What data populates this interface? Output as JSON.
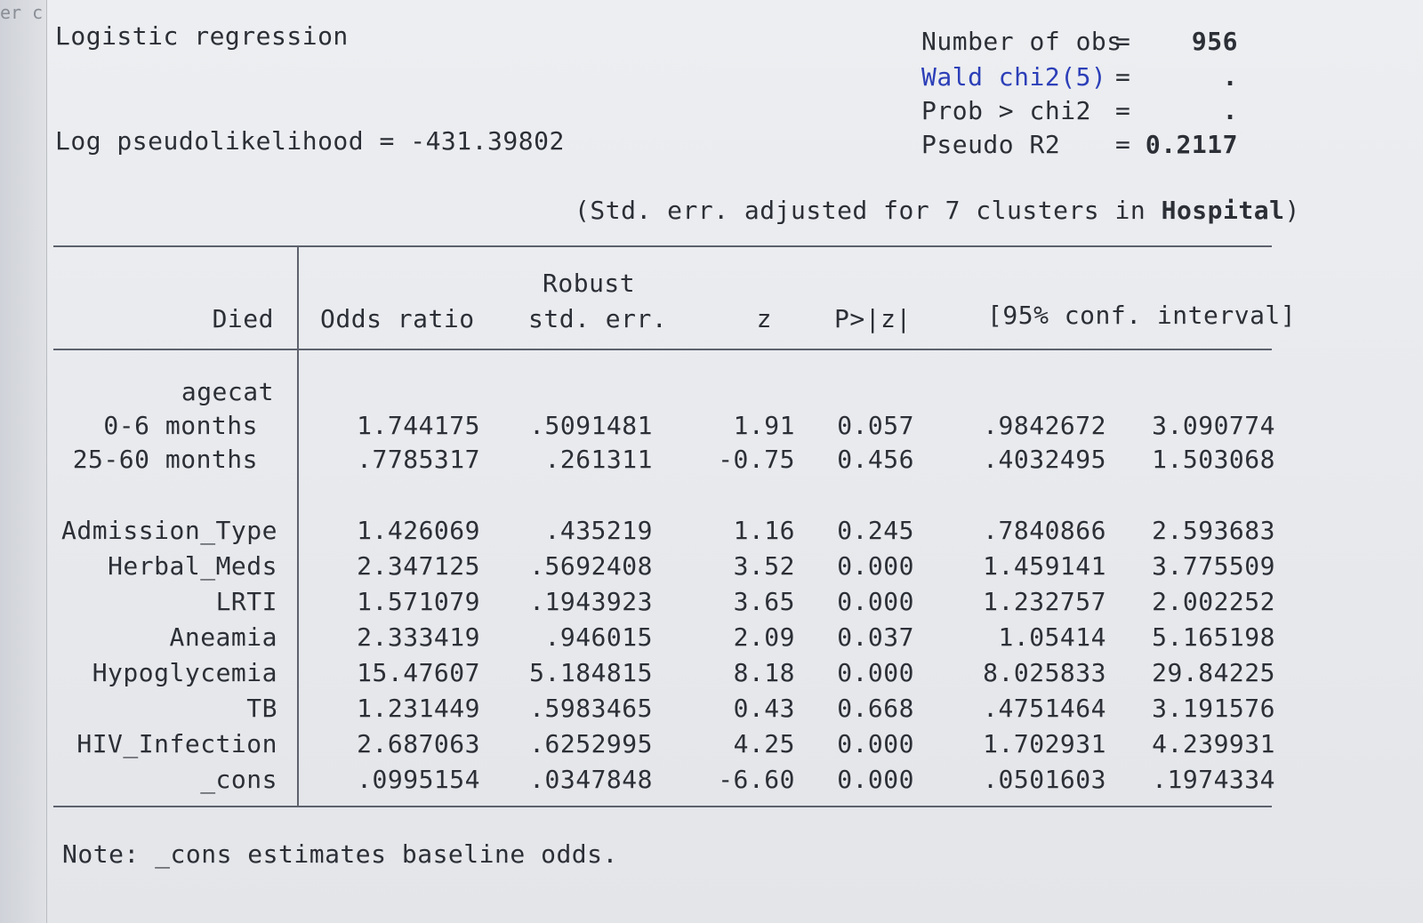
{
  "sidebar": {
    "tab_fragment": "er c"
  },
  "header": {
    "title": "Logistic regression",
    "loglik": "Log pseudolikelihood = -431.39802",
    "stats": [
      {
        "label": "Number of obs",
        "eq": "=",
        "value": "956",
        "link": false
      },
      {
        "label": "Wald chi2(5)",
        "eq": "=",
        "value": ".",
        "link": true
      },
      {
        "label": "Prob > chi2",
        "eq": "=",
        "value": ".",
        "link": false
      },
      {
        "label": "Pseudo R2",
        "eq": "=",
        "value": "0.2117",
        "link": false
      }
    ],
    "cluster_note_prefix": "(Std. err. adjusted for 7 clusters in ",
    "cluster_var": "Hospital",
    "cluster_note_suffix": ")"
  },
  "table": {
    "depvar": "Died",
    "col_odds": "Odds ratio",
    "col_robust": "Robust",
    "col_se": "std. err.",
    "col_z": "z",
    "col_p": "P>|z|",
    "col_ci": "[95% conf. interval]",
    "group_label": "agecat",
    "rows": [
      {
        "label": "0-6 months",
        "or": "1.744175",
        "se": ".5091481",
        "z": "1.91",
        "p": "0.057",
        "lo": ".9842672",
        "hi": "3.090774"
      },
      {
        "label": "25-60 months",
        "or": ".7785317",
        "se": ".261311",
        "z": "-0.75",
        "p": "0.456",
        "lo": ".4032495",
        "hi": "1.503068"
      },
      {
        "label": "Admission_Type",
        "or": "1.426069",
        "se": ".435219",
        "z": "1.16",
        "p": "0.245",
        "lo": ".7840866",
        "hi": "2.593683"
      },
      {
        "label": "Herbal_Meds",
        "or": "2.347125",
        "se": ".5692408",
        "z": "3.52",
        "p": "0.000",
        "lo": "1.459141",
        "hi": "3.775509"
      },
      {
        "label": "LRTI",
        "or": "1.571079",
        "se": ".1943923",
        "z": "3.65",
        "p": "0.000",
        "lo": "1.232757",
        "hi": "2.002252"
      },
      {
        "label": "Aneamia",
        "or": "2.333419",
        "se": ".946015",
        "z": "2.09",
        "p": "0.037",
        "lo": "1.05414",
        "hi": "5.165198"
      },
      {
        "label": "Hypoglycemia",
        "or": "15.47607",
        "se": "5.184815",
        "z": "8.18",
        "p": "0.000",
        "lo": "8.025833",
        "hi": "29.84225"
      },
      {
        "label": "TB",
        "or": "1.231449",
        "se": ".5983465",
        "z": "0.43",
        "p": "0.668",
        "lo": ".4751464",
        "hi": "3.191576"
      },
      {
        "label": "HIV_Infection",
        "or": "2.687063",
        "se": ".6252995",
        "z": "4.25",
        "p": "0.000",
        "lo": "1.702931",
        "hi": "4.239931"
      },
      {
        "label": "_cons",
        "or": ".0995154",
        "se": ".0347848",
        "z": "-6.60",
        "p": "0.000",
        "lo": ".0501603",
        "hi": ".1974334"
      }
    ]
  },
  "note": "Note: _cons estimates baseline odds."
}
